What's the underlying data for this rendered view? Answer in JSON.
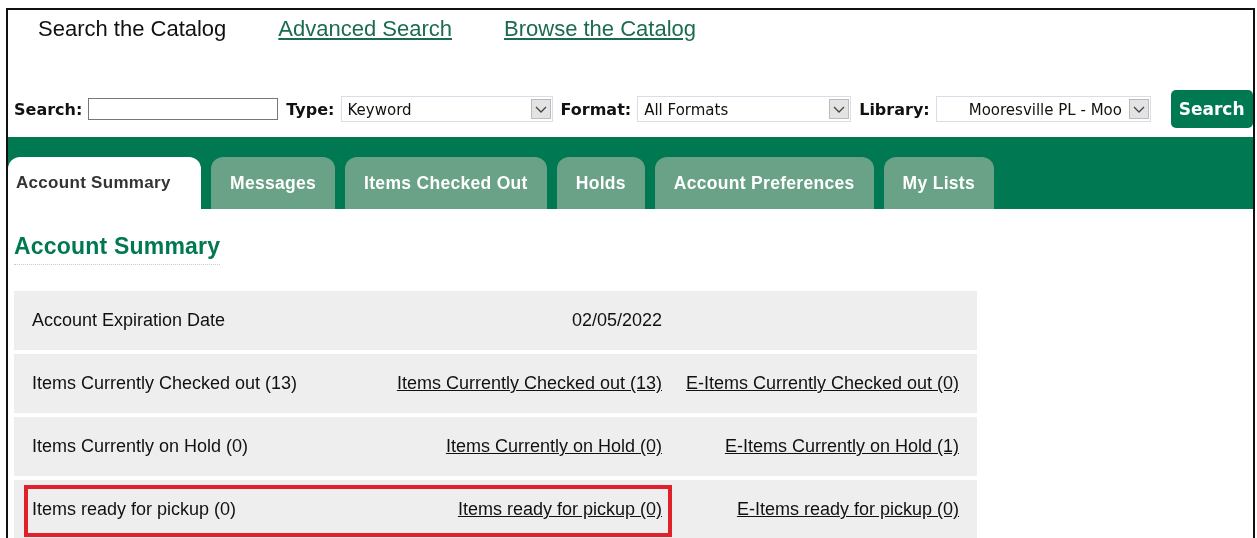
{
  "nav_links": [
    {
      "label": "Search the Catalog",
      "kind": "text"
    },
    {
      "label": "Advanced Search",
      "kind": "link"
    },
    {
      "label": "Browse the Catalog",
      "kind": "link"
    }
  ],
  "search_bar": {
    "search_label": "Search:",
    "fields": [
      {
        "label": "Type:",
        "value": "Keyword"
      },
      {
        "label": "Format:",
        "value": "All Formats"
      },
      {
        "label": "Library:",
        "value": "Mooresville PL - Moo"
      }
    ],
    "button": "Search"
  },
  "tabs": [
    {
      "label": "Account Summary",
      "selected": true
    },
    {
      "label": "Messages",
      "selected": false
    },
    {
      "label": "Items Checked Out",
      "selected": false
    },
    {
      "label": "Holds",
      "selected": false
    },
    {
      "label": "Account Preferences",
      "selected": false
    },
    {
      "label": "My Lists",
      "selected": false
    }
  ],
  "heading": "Account Summary",
  "rows": [
    {
      "highlighted": false,
      "cells": [
        {
          "kind": "text",
          "text": "Account Expiration Date"
        },
        {
          "kind": "text",
          "text": "02/05/2022"
        }
      ]
    },
    {
      "highlighted": false,
      "cells": [
        {
          "kind": "text",
          "text": "Items Currently Checked out (13)"
        },
        {
          "kind": "link",
          "text": "Items Currently Checked out (13)"
        },
        {
          "kind": "link",
          "text": "E-Items Currently Checked out (0)"
        }
      ]
    },
    {
      "highlighted": false,
      "cells": [
        {
          "kind": "text",
          "text": "Items Currently on Hold (0)"
        },
        {
          "kind": "link",
          "text": "Items Currently on Hold (0)"
        },
        {
          "kind": "link",
          "text": "E-Items Currently on Hold (1)"
        }
      ]
    },
    {
      "highlighted": true,
      "cells": [
        {
          "kind": "text",
          "text": "Items ready for pickup (0)"
        },
        {
          "kind": "link",
          "text": "Items ready for pickup (0)"
        },
        {
          "kind": "link",
          "text": "E-Items ready for pickup (0)"
        }
      ]
    }
  ]
}
